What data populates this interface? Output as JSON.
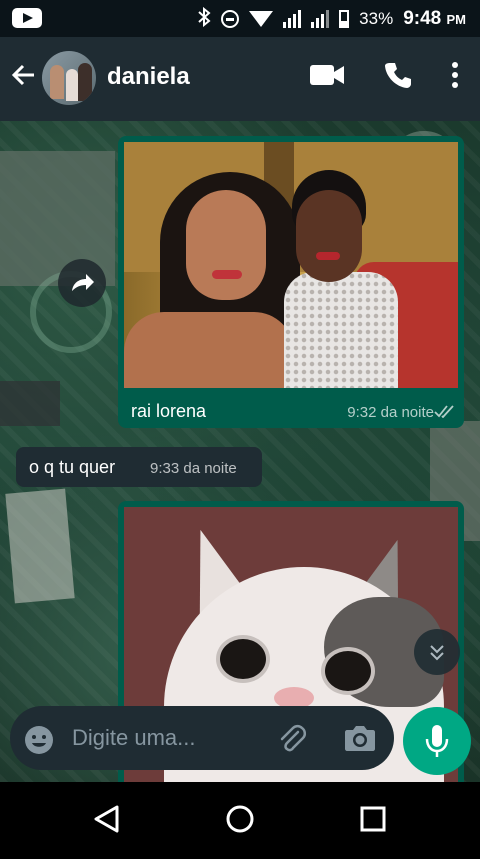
{
  "status_bar": {
    "battery": "33%",
    "time": "9:48",
    "ampm": "PM"
  },
  "header": {
    "contact_name": "daniela",
    "icons": [
      "back-arrow-icon",
      "avatar",
      "video-call-icon",
      "voice-call-icon",
      "overflow-menu-icon"
    ]
  },
  "messages": [
    {
      "direction": "out",
      "type": "image",
      "caption": "rai lorena",
      "time": "9:32 da noite",
      "status": "read"
    },
    {
      "direction": "in",
      "type": "text",
      "text": "o q tu quer",
      "time": "9:33 da noite"
    },
    {
      "direction": "out",
      "type": "image",
      "caption": "",
      "time": ""
    }
  ],
  "composer": {
    "placeholder": "Digite uma..."
  },
  "colors": {
    "app_bar": "#1f2c33",
    "outgoing_bubble": "#005c4b",
    "incoming_bubble": "#1f2c33",
    "accent": "#00a884"
  }
}
